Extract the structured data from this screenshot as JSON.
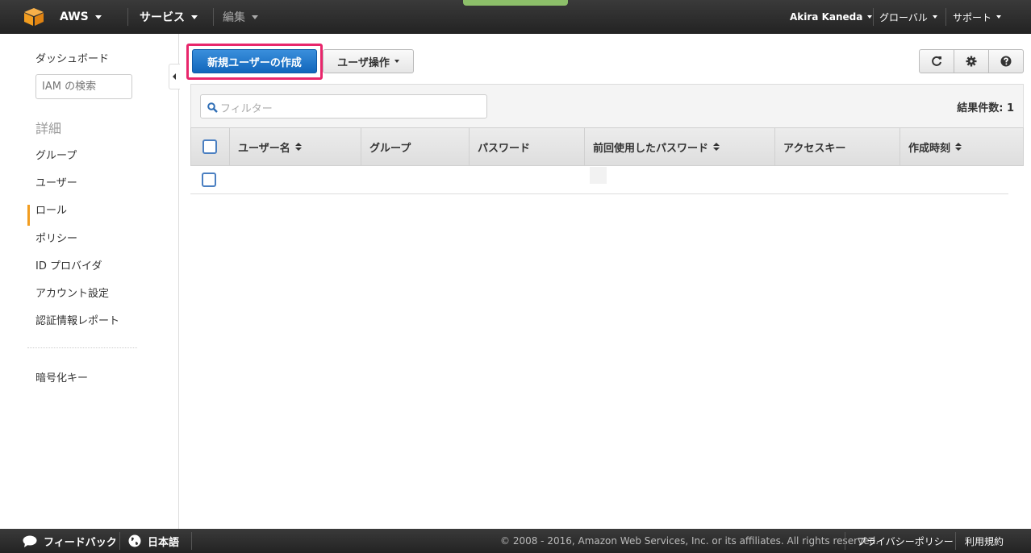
{
  "topnav": {
    "brand": "AWS",
    "services_label": "サービス",
    "edit_label": "編集",
    "user_name": "Akira Kaneda",
    "region_label": "グローバル",
    "support_label": "サポート"
  },
  "sidebar": {
    "dashboard": "ダッシュボード",
    "search_placeholder": "IAM の検索",
    "section_heading": "詳細",
    "items": [
      {
        "label": "グループ"
      },
      {
        "label": "ユーザー",
        "active": true
      },
      {
        "label": "ロール"
      },
      {
        "label": "ポリシー"
      },
      {
        "label": "ID プロバイダ"
      },
      {
        "label": "アカウント設定"
      },
      {
        "label": "認証情報レポート"
      }
    ],
    "encryption_keys": "暗号化キー"
  },
  "toolbar": {
    "create_user_label": "新規ユーザーの作成",
    "user_actions_label": "ユーザ操作",
    "icons": [
      "refresh-icon",
      "gear-icon",
      "help-icon"
    ]
  },
  "table": {
    "filter_placeholder": "フィルター",
    "result_count": "結果件数: 1",
    "columns": [
      {
        "label": "ユーザー名",
        "sortable": true
      },
      {
        "label": "グループ",
        "sortable": false
      },
      {
        "label": "パスワード",
        "sortable": false
      },
      {
        "label": "前回使用したパスワード",
        "sortable": true
      },
      {
        "label": "アクセスキー",
        "sortable": false
      },
      {
        "label": "作成時刻",
        "sortable": true
      }
    ],
    "rows": [
      {
        "cells": [
          "",
          "",
          "",
          "",
          "",
          ""
        ]
      }
    ]
  },
  "footer": {
    "feedback_label": "フィードバック",
    "language_label": "日本語",
    "copyright": "© 2008 - 2016, Amazon Web Services, Inc. or its affiliates. All rights reserved.",
    "privacy_label": "プライバシーポリシー",
    "terms_label": "利用規約"
  },
  "colors": {
    "primary_button": "#1166bb",
    "highlight_border": "#e8266b",
    "active_marker": "#f29d20",
    "nav_background": "#232323",
    "nav_accent": "#8dc06a"
  }
}
